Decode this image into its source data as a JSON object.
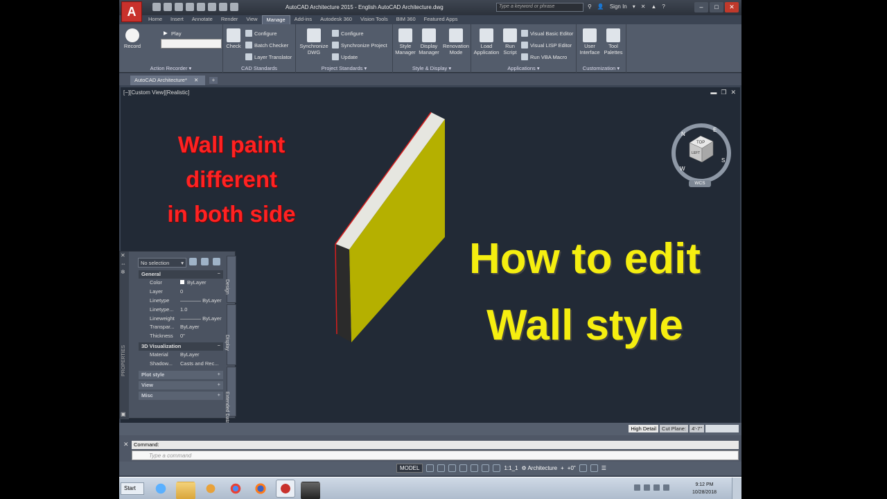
{
  "app": {
    "title": "AutoCAD Architecture 2015 - English   AutoCAD Architecture.dwg",
    "logo_letter": "A",
    "search_placeholder": "Type a keyword or phrase",
    "sign_in": "Sign In"
  },
  "ribbon_tabs": [
    "Home",
    "Insert",
    "Annotate",
    "Render",
    "View",
    "Manage",
    "Add-ins",
    "Autodesk 360",
    "Vision Tools",
    "BIM 360",
    "Featured Apps"
  ],
  "active_tab": "Manage",
  "ribbon": {
    "action_recorder": {
      "record": "Record",
      "play": "Play",
      "title": "Action Recorder"
    },
    "cad_standards": {
      "check": "Check",
      "configure": "Configure",
      "batch_checker": "Batch Checker",
      "layer_translator": "Layer Translator",
      "title": "CAD Standards"
    },
    "project_standards": {
      "sync_dwg": "Synchronize DWG",
      "configure": "Configure",
      "sync_project": "Synchronize Project",
      "update": "Update",
      "title": "Project Standards"
    },
    "style_display": {
      "style_manager": "Style Manager",
      "display_manager": "Display Manager",
      "renovation_mode": "Renovation Mode",
      "title": "Style & Display"
    },
    "applications": {
      "load_application": "Load Application",
      "run_script": "Run Script",
      "visual_basic": "Visual Basic Editor",
      "visual_lisp": "Visual LISP Editor",
      "run_vba": "Run VBA Macro",
      "title": "Applications"
    },
    "customization": {
      "user_interface": "User Interface",
      "tool_palettes": "Tool Palettes",
      "title": "Customization"
    }
  },
  "document_tab": "AutoCAD Architecture*",
  "viewport": {
    "label": "[−][Custom View][Realistic]",
    "overlay_red": [
      "Wall paint",
      "different",
      "in both side"
    ],
    "overlay_yellow": [
      "How to edit",
      "Wall style"
    ],
    "viewcube": {
      "face": "TOP",
      "left": "LEFT",
      "north": "N",
      "east": "E",
      "south": "S",
      "west": "W"
    },
    "wcs": "WCS"
  },
  "properties": {
    "selection": "No selection",
    "palette_label": "PROPERTIES",
    "side_tabs": [
      "Design",
      "Display",
      "Extended Data"
    ],
    "general": {
      "title": "General",
      "rows": [
        {
          "key": "Color",
          "value": "ByLayer"
        },
        {
          "key": "Layer",
          "value": "0"
        },
        {
          "key": "Linetype",
          "value": "———— ByLayer"
        },
        {
          "key": "Linetype...",
          "value": "1.0"
        },
        {
          "key": "Lineweight",
          "value": "———— ByLayer"
        },
        {
          "key": "Transpar...",
          "value": "ByLayer"
        },
        {
          "key": "Thickness",
          "value": "0\""
        }
      ]
    },
    "visualization": {
      "title": "3D Visualization",
      "rows": [
        {
          "key": "Material",
          "value": "ByLayer"
        },
        {
          "key": "Shadow...",
          "value": "Casts and Rec..."
        }
      ]
    },
    "collapsed": [
      "Plot style",
      "View",
      "Misc"
    ]
  },
  "status_right": {
    "detail": "High Detail",
    "cut_plane_label": "Cut Plane:",
    "cut_plane_value": "4'-7\""
  },
  "command": {
    "history": "Command:",
    "placeholder": "Type a command"
  },
  "statusbar": {
    "model": "MODEL",
    "scale": "1:1_1",
    "workspace": "Architecture",
    "elevation": "+0\""
  },
  "taskbar": {
    "start": "Start",
    "time": "9:12 PM",
    "date": "10/28/2018"
  }
}
